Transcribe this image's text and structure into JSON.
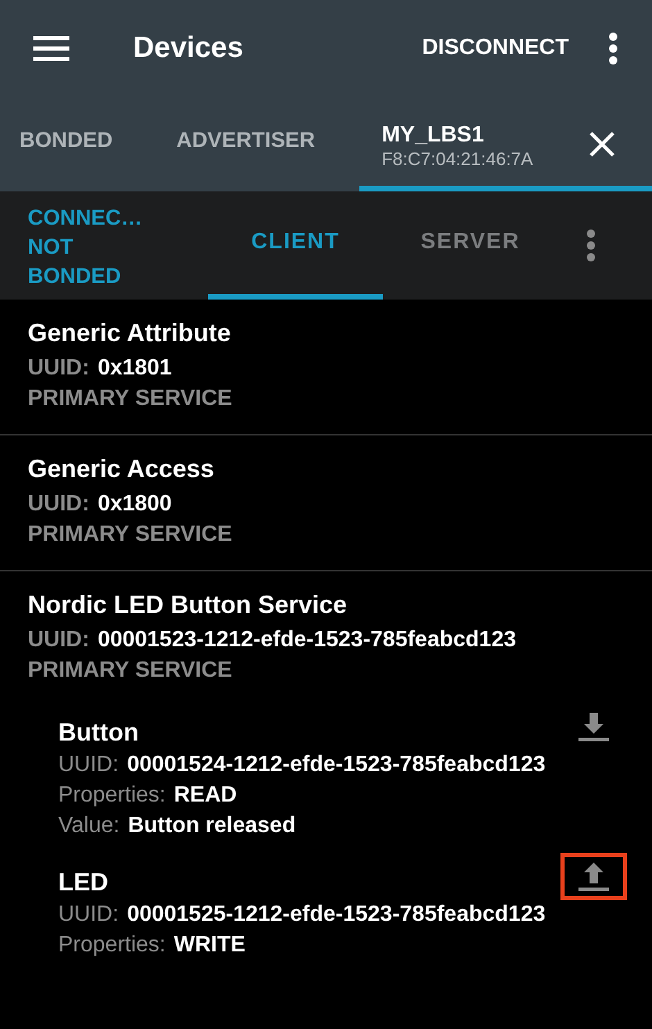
{
  "app_bar": {
    "title": "Devices",
    "action": "DISCONNECT"
  },
  "device_tabs": [
    {
      "label": "BONDED",
      "selected": false
    },
    {
      "label": "ADVERTISER",
      "selected": false
    },
    {
      "label": "MY_LBS1",
      "address": "F8:C7:04:21:46:7A",
      "selected": true
    }
  ],
  "connection": {
    "state": "CONNEC…",
    "bond": "NOT BONDED"
  },
  "mode_tabs": [
    {
      "label": "CLIENT",
      "selected": true
    },
    {
      "label": "SERVER",
      "selected": false
    }
  ],
  "services": [
    {
      "name": "Generic Attribute",
      "uuid_label": "UUID:",
      "uuid": "0x1801",
      "type": "PRIMARY SERVICE"
    },
    {
      "name": "Generic Access",
      "uuid_label": "UUID:",
      "uuid": "0x1800",
      "type": "PRIMARY SERVICE"
    },
    {
      "name": "Nordic LED Button Service",
      "uuid_label": "UUID:",
      "uuid": "00001523-1212-efde-1523-785feabcd123",
      "type": "PRIMARY SERVICE",
      "characteristics": [
        {
          "name": "Button",
          "kind": "read",
          "highlighted": false,
          "fields": [
            {
              "label": "UUID:",
              "value": "00001524-1212-efde-1523-785feabcd123"
            },
            {
              "label": "Properties:",
              "value": "READ"
            },
            {
              "label": "Value:",
              "value": "Button released"
            }
          ]
        },
        {
          "name": "LED",
          "kind": "write",
          "highlighted": true,
          "fields": [
            {
              "label": "UUID:",
              "value": "00001525-1212-efde-1523-785feabcd123"
            },
            {
              "label": "Properties:",
              "value": "WRITE"
            }
          ]
        }
      ]
    }
  ]
}
